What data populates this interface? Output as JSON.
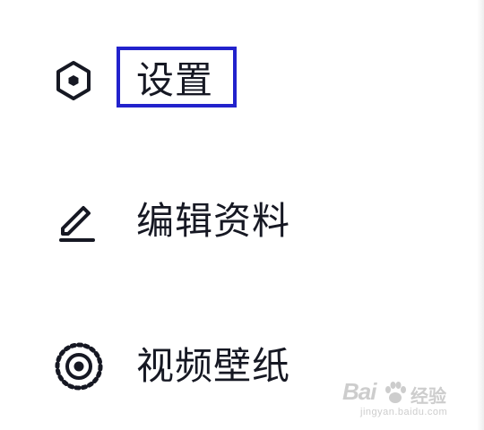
{
  "menu": {
    "items": [
      {
        "id": "settings",
        "label": "设置",
        "icon": "hexagon-settings-icon",
        "highlighted": true
      },
      {
        "id": "edit-profile",
        "label": "编辑资料",
        "icon": "pencil-edit-icon",
        "highlighted": false
      },
      {
        "id": "video-wallpaper",
        "label": "视频壁纸",
        "icon": "wallpaper-ring-icon",
        "highlighted": false
      }
    ]
  },
  "highlight": {
    "color": "#2222cc"
  },
  "watermark": {
    "brand": "Bai",
    "brand_cn": "经验",
    "url": "jingyan.baidu.com"
  },
  "colors": {
    "text": "#161823",
    "background": "#ffffff"
  }
}
